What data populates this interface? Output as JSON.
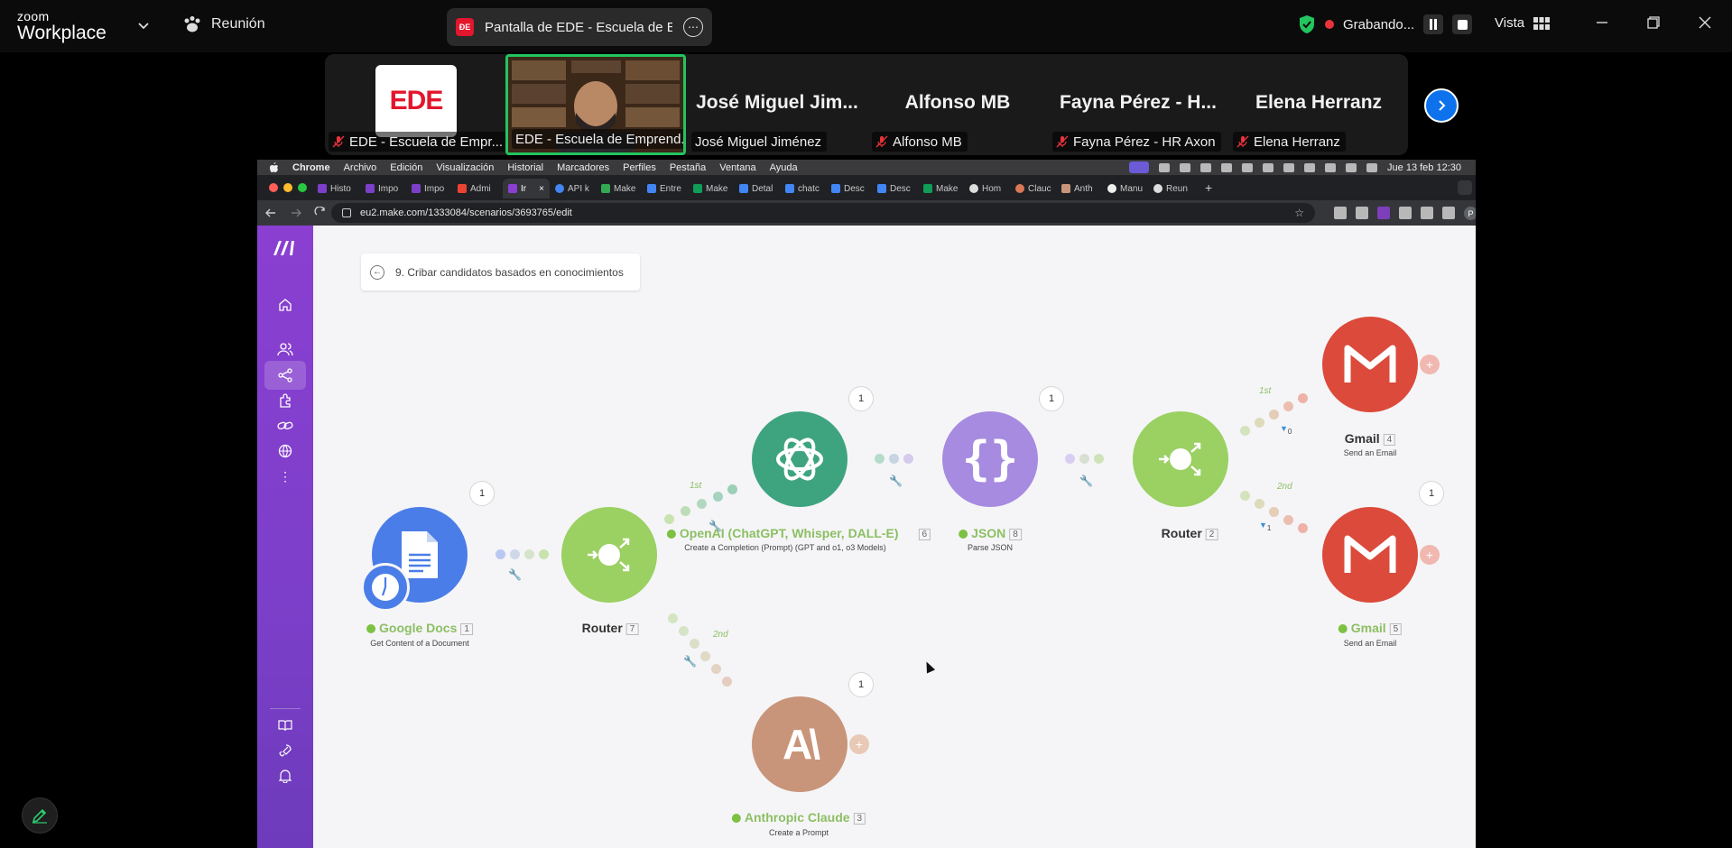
{
  "zoom": {
    "brand_top": "zoom",
    "brand_bottom": "Workplace",
    "meeting_label": "Reunión",
    "share_title": "Pantalla de EDE - Escuela de Emp",
    "recording_label": "Grabando...",
    "view_label": "Vista"
  },
  "gallery": {
    "tiles": [
      {
        "caption": "EDE - Escuela de Empr...",
        "logo": "EDE"
      },
      {
        "caption": "EDE - Escuela de Emprend..."
      },
      {
        "name": "José Miguel Jim...",
        "caption": "José Miguel Jiménez"
      },
      {
        "name": "Alfonso MB",
        "caption": "Alfonso MB"
      },
      {
        "name": "Fayna Pérez - H...",
        "caption": "Fayna Pérez - HR Axon"
      },
      {
        "name": "Elena Herranz",
        "caption": "Elena Herranz"
      }
    ]
  },
  "mac": {
    "menu": [
      "Chrome",
      "Archivo",
      "Edición",
      "Visualización",
      "Historial",
      "Marcadores",
      "Perfiles",
      "Pestaña",
      "Ventana",
      "Ayuda"
    ],
    "clock": "Jue 13 feb 12:30"
  },
  "chrome": {
    "tabs": [
      "Histo",
      "Impo",
      "Impo",
      "Admi",
      "Ir",
      "API k",
      "Make",
      "Entre",
      "Make",
      "Detal",
      "chatc",
      "Desc",
      "Desc",
      "Make",
      "Hom",
      "Clauc",
      "Anth",
      "Manu",
      "Reun"
    ],
    "url": "eu2.make.com/1333084/scenarios/3693765/edit",
    "profile_initial": "P"
  },
  "scenario": {
    "breadcrumb": "9. Cribar candidatos basados en conocimientos",
    "nodes": {
      "gdocs": {
        "name": "Google Docs",
        "id": "1",
        "sub": "Get Content of a Document"
      },
      "router1": {
        "name": "Router",
        "id": "7"
      },
      "openai": {
        "name": "OpenAI (ChatGPT, Whisper, DALL-E)",
        "id": "6",
        "sub": "Create a Completion (Prompt) (GPT and o1, o3 Models)"
      },
      "json": {
        "name": "JSON",
        "id": "8",
        "sub": "Parse JSON"
      },
      "router2": {
        "name": "Router",
        "id": "2"
      },
      "gmail1": {
        "name": "Gmail",
        "id": "4",
        "sub": "Send an Email"
      },
      "gmail2": {
        "name": "Gmail",
        "id": "5",
        "sub": "Send an Email"
      },
      "claude": {
        "name": "Anthropic Claude",
        "id": "3",
        "sub": "Create a Prompt"
      }
    },
    "bubbles": [
      "1",
      "1",
      "1",
      "1",
      "1",
      "1"
    ],
    "routes": [
      "1st",
      "2nd",
      "1st",
      "2nd"
    ],
    "filters": [
      "0",
      "1"
    ]
  },
  "colors": {
    "make_purple": "#7c3fc9",
    "router_green": "#9bd062",
    "openai_teal": "#3ea47f",
    "json_purple": "#a78be0",
    "gmail_red": "#db4a3b",
    "gdocs_blue": "#4a7de8",
    "claude_tan": "#c8957a",
    "zoom_blue": "#0e72ed"
  }
}
